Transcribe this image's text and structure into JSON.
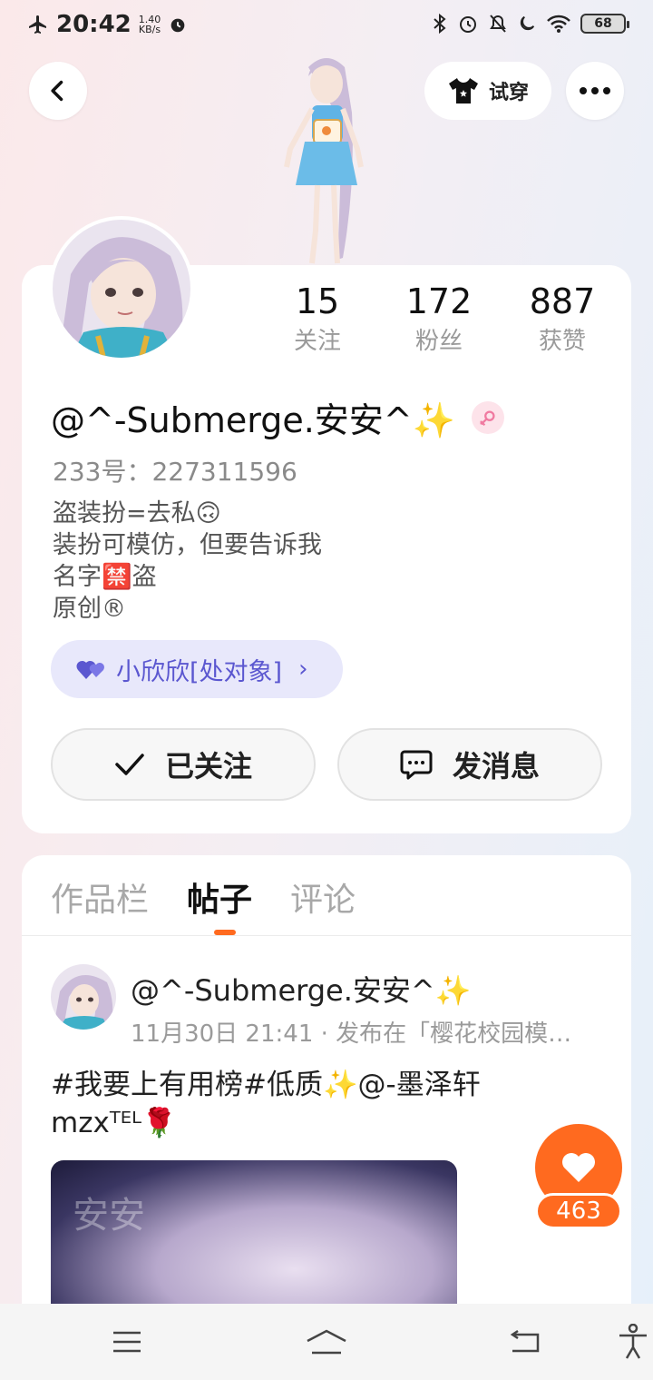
{
  "status_bar": {
    "time": "20:42",
    "speed_value": "1.40",
    "speed_unit": "KB/s",
    "battery": "68"
  },
  "header": {
    "try_on_label": "试穿"
  },
  "profile": {
    "stats": [
      {
        "value": "15",
        "label": "关注"
      },
      {
        "value": "172",
        "label": "粉丝"
      },
      {
        "value": "887",
        "label": "获赞"
      }
    ],
    "nickname": "@^-Submerge.安安^✨",
    "uid": "233号：227311596",
    "bio": [
      "盗装扮=去私🙃",
      "装扮可模仿，但要告诉我",
      "名字🈲盗",
      "原创®"
    ],
    "cp_label": "小欣欣[处对象]",
    "follow_label": "已关注",
    "message_label": "发消息"
  },
  "tabs": [
    {
      "label": "作品栏"
    },
    {
      "label": "帖子"
    },
    {
      "label": "评论"
    }
  ],
  "post": {
    "author": "@^-Submerge.安安^✨",
    "meta": "11月30日 21:41 · 发布在「樱花校园模…",
    "text": "#我要上有用榜#低质✨@-墨泽轩mzxᵀᴱᴸ🌹",
    "image_watermark": "安安"
  },
  "like": {
    "count": "463"
  },
  "colors": {
    "accent": "#ff6a1f",
    "cp_text": "#5b57d0",
    "cp_bg": "#e8e8fb"
  }
}
